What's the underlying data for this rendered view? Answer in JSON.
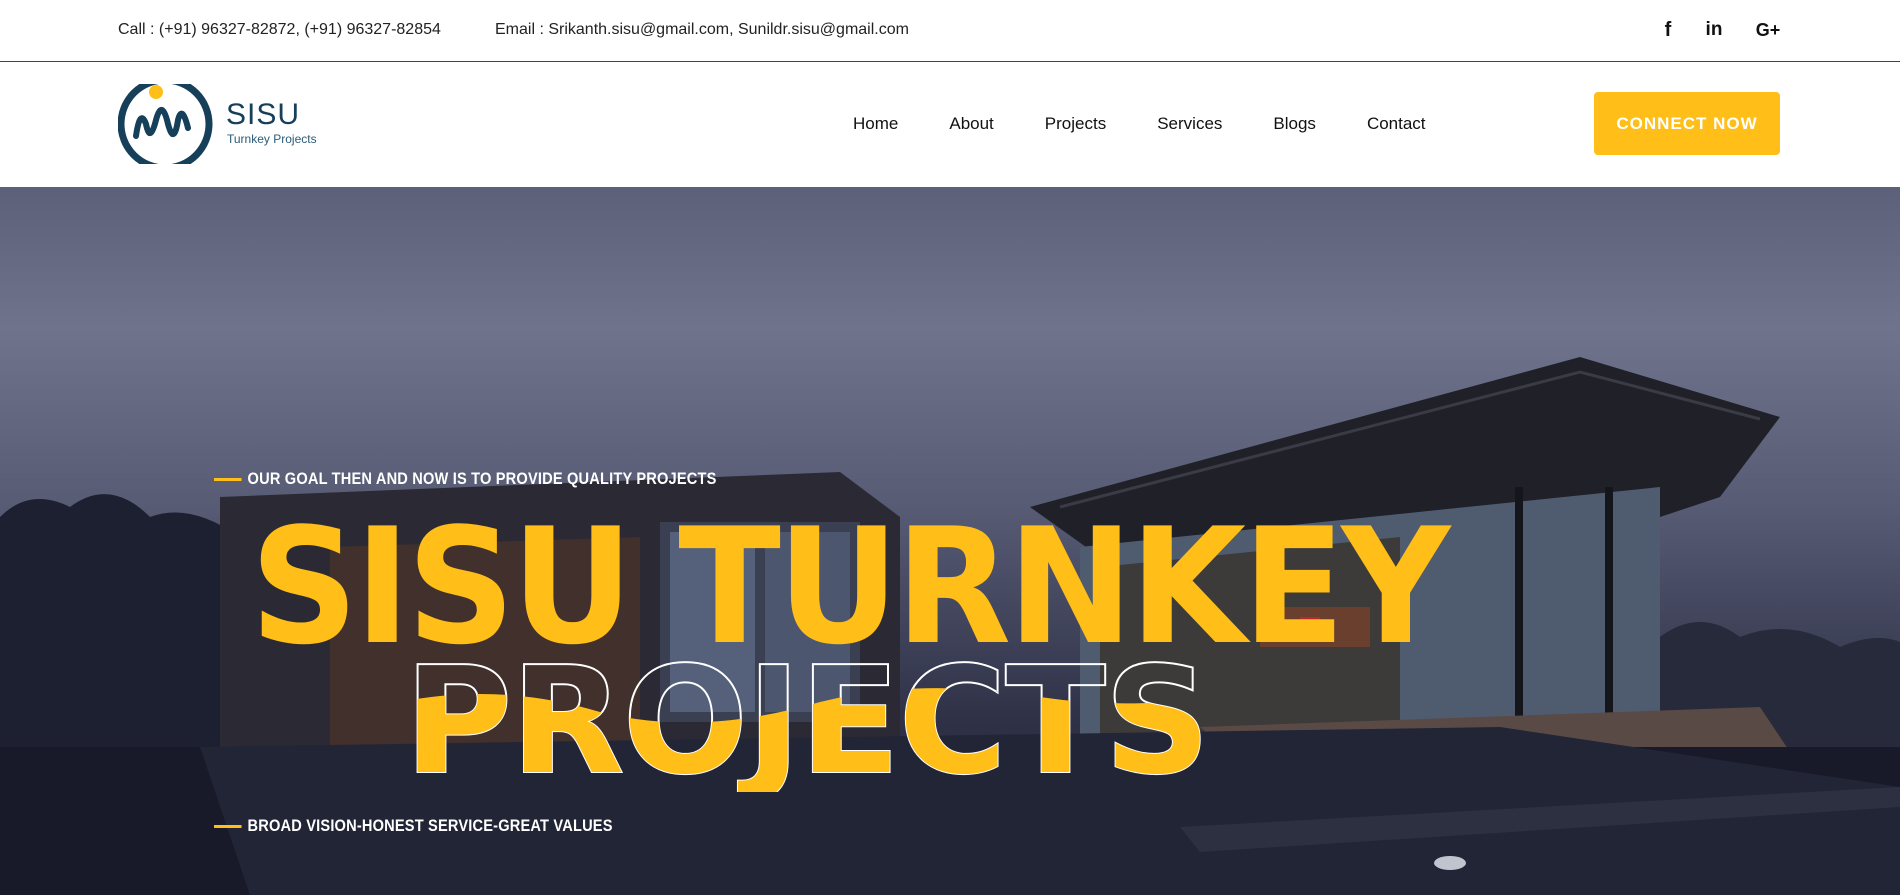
{
  "topbar": {
    "call_text": "Call : (+91) 96327-82872, (+91) 96327-82854",
    "email_text": "Email : Srikanth.sisu@gmail.com, Sunildr.sisu@gmail.com",
    "social": [
      {
        "icon": "facebook-icon",
        "glyph": "f"
      },
      {
        "icon": "linkedin-icon",
        "glyph": "in"
      },
      {
        "icon": "google-plus-icon",
        "glyph": "G+"
      }
    ]
  },
  "header": {
    "logo": {
      "name": "SISU",
      "sub": "Turnkey Projects"
    },
    "nav": [
      "Home",
      "About",
      "Projects",
      "Services",
      "Blogs",
      "Contact"
    ],
    "cta_label": "CONNECT NOW"
  },
  "hero": {
    "tagline_top": "OUR GOAL THEN AND NOW IS TO PROVIDE QUALITY PROJECTS",
    "title_line1": "SISU TURNKEY",
    "title_line2": "PROJECTS",
    "tagline_bottom": "BROAD VISION-HONEST SERVICE-GREAT VALUES"
  },
  "colors": {
    "accent": "#ffbe18",
    "brand_dark": "#163f5a",
    "text_dark": "#111111",
    "white": "#ffffff"
  }
}
